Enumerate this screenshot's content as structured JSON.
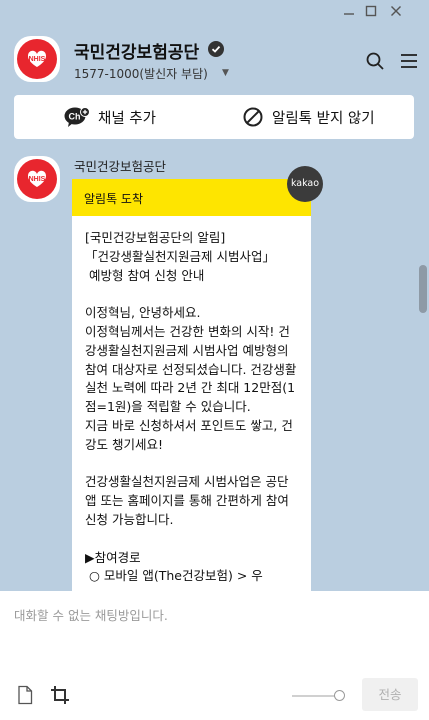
{
  "window": {
    "minimize": "—",
    "maximize": "□",
    "close": "✕"
  },
  "header": {
    "title": "국민건강보험공단",
    "subtitle": "1577-1000(발신자 부담)",
    "caret": "▼",
    "avatar_text": "NHIS",
    "icons": [
      "verified-icon",
      "search-icon",
      "menu-icon"
    ]
  },
  "actions": {
    "add_channel": "채널 추가",
    "block_alimtalk": "알림톡 받지 않기",
    "ch_badge": "Ch"
  },
  "message": {
    "sender": "국민건강보험공단",
    "avatar_text": "NHIS",
    "header": "알림톡 도착",
    "badge": "kakao",
    "body": "[국민건강보험공단의 알림]\n「건강생활실천지원금제 시범사업」\n 예방형 참여 신청 안내\n\n이정혁님, 안녕하세요.\n이정혁님께서는 건강한 변화의 시작! 건강생활실천지원금제 시범사업 예방형의 참여 대상자로 선정되셨습니다. 건강생활 실천 노력에 따라 2년 간 최대 12만점(1점=1원)을 적립할 수 있습니다.\n지금 바로 신청하셔서 포인트도 쌓고, 건강도 챙기세요!\n\n건강생활실천지원금제 시범사업은 공단 앱 또는 홈페이지를 통해 간편하게 참여 신청 가능합니다.\n\n▶참여경로\n ○ 모바일 앱(The건강보험) > 우"
  },
  "input": {
    "placeholder": "대화할 수 없는 채팅방입니다.",
    "send": "전송"
  },
  "colors": {
    "background": "#bacee0",
    "alimtalk_header": "#fee500",
    "logo_red": "#e8262e"
  }
}
